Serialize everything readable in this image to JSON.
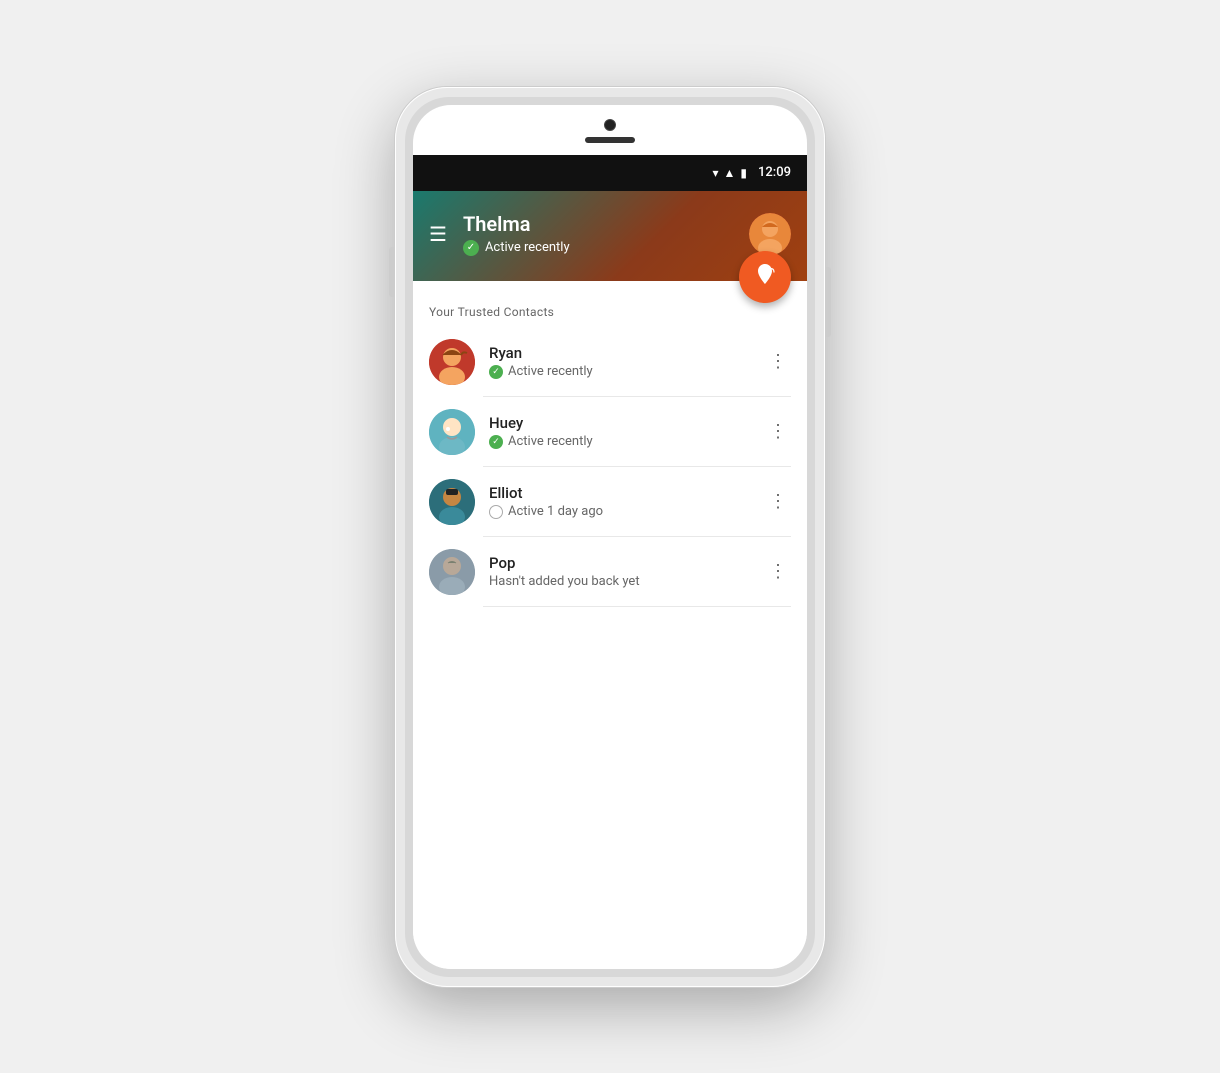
{
  "phone": {
    "status_bar": {
      "time": "12:09",
      "wifi": "▾",
      "signal": "▲",
      "battery": "▮"
    }
  },
  "header": {
    "menu_label": "☰",
    "contact_name": "Thelma",
    "active_status": "Active recently",
    "fab_icon": "📍"
  },
  "contacts_section": {
    "label": "Your Trusted Contacts",
    "contacts": [
      {
        "name": "Ryan",
        "status_text": "Active recently",
        "status_type": "active",
        "avatar_color": "#c0392b",
        "avatar_type": "ryan"
      },
      {
        "name": "Huey",
        "status_text": "Active recently",
        "status_type": "active",
        "avatar_color": "#5fb3c0",
        "avatar_type": "huey"
      },
      {
        "name": "Elliot",
        "status_text": "Active 1 day ago",
        "status_type": "away",
        "avatar_color": "#2c6e7a",
        "avatar_type": "elliot"
      },
      {
        "name": "Pop",
        "status_text": "Hasn't added you back yet",
        "status_type": "none",
        "avatar_color": "#8a9ba8",
        "avatar_type": "pop"
      }
    ]
  }
}
